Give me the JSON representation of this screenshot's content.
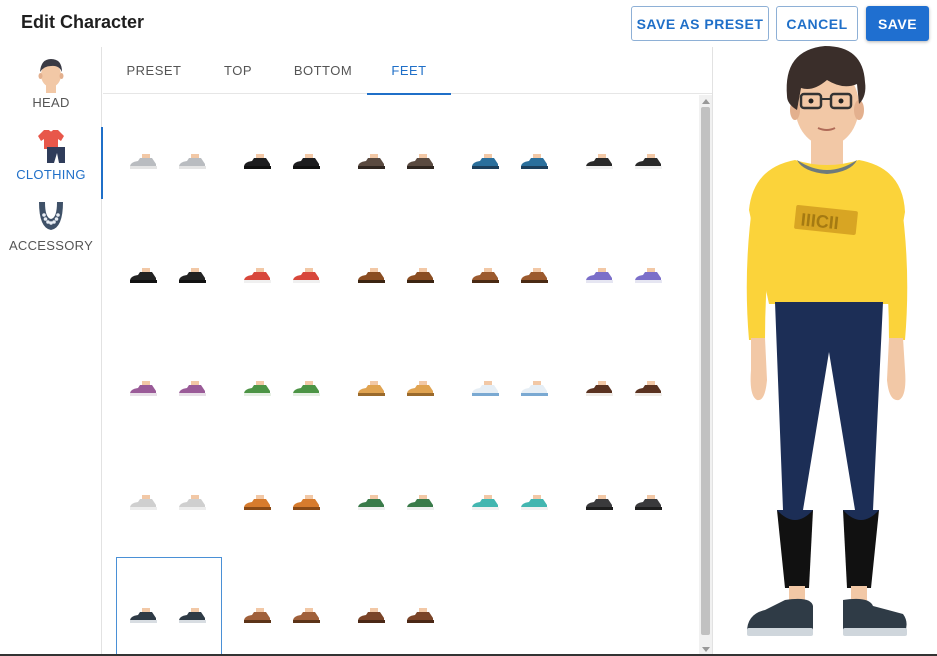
{
  "header": {
    "title": "Edit Character",
    "save_as_preset": "SAVE AS PRESET",
    "cancel": "CANCEL",
    "save": "SAVE"
  },
  "categories": [
    {
      "label": "HEAD",
      "icon": "head-icon",
      "active": false
    },
    {
      "label": "CLOTHING",
      "icon": "clothing-icon",
      "active": true
    },
    {
      "label": "ACCESSORY",
      "icon": "necklace-icon",
      "active": false
    }
  ],
  "tabs": [
    {
      "label": "PRESET",
      "active": false
    },
    {
      "label": "TOP",
      "active": false
    },
    {
      "label": "BOTTOM",
      "active": false
    },
    {
      "label": "FEET",
      "active": true
    }
  ],
  "shoes": [
    {
      "name": "grey-sneaker",
      "color": "#b9bcc0",
      "sole": "#e4e4e4"
    },
    {
      "name": "black-dress-shoe",
      "color": "#1d1d1f",
      "sole": "#111111"
    },
    {
      "name": "dark-brown-shoe",
      "color": "#5a4a40",
      "sole": "#2f2620"
    },
    {
      "name": "blue-shoe",
      "color": "#2a6f9c",
      "sole": "#1c3f5c"
    },
    {
      "name": "black-white-sandal",
      "color": "#2a2a2a",
      "sole": "#f2f2f2"
    },
    {
      "name": "black-flat",
      "color": "#232323",
      "sole": "#111111"
    },
    {
      "name": "red-white-sneaker",
      "color": "#d8473b",
      "sole": "#f0f0f0"
    },
    {
      "name": "brown-loafer",
      "color": "#8a4d22",
      "sole": "#3b2412"
    },
    {
      "name": "tan-loafer",
      "color": "#9c5a2e",
      "sole": "#4a2a14"
    },
    {
      "name": "purple-sneaker",
      "color": "#7b6fc9",
      "sole": "#e6e6f2"
    },
    {
      "name": "mauve-sneaker",
      "color": "#9a5b98",
      "sole": "#e8e0e8"
    },
    {
      "name": "green-sneaker",
      "color": "#4c9445",
      "sole": "#e6efe4"
    },
    {
      "name": "tan-boot",
      "color": "#e0a351",
      "sole": "#9a6a2c"
    },
    {
      "name": "white-blue-sneaker",
      "color": "#e6eef5",
      "sole": "#7aa9d2"
    },
    {
      "name": "brown-boot",
      "color": "#5a3220",
      "sole": "#f0ece8"
    },
    {
      "name": "light-grey-sneaker",
      "color": "#cfcfcf",
      "sole": "#ededed"
    },
    {
      "name": "orange-sandal",
      "color": "#d77b2d",
      "sole": "#8a4a16"
    },
    {
      "name": "green-stripe-sneaker",
      "color": "#3a7b4a",
      "sole": "#f0f0f0"
    },
    {
      "name": "teal-sneaker",
      "color": "#43b6b0",
      "sole": "#f2f2f2"
    },
    {
      "name": "charcoal-shoe",
      "color": "#3a3a3c",
      "sole": "#1d1d1d"
    },
    {
      "name": "navy-sneaker",
      "color": "#2f3b46",
      "sole": "#d8dde2"
    },
    {
      "name": "brown-sandal",
      "color": "#a0603a",
      "sole": "#5c3418"
    },
    {
      "name": "brown-clog",
      "color": "#7a4428",
      "sole": "#4a2816"
    }
  ],
  "selected_shoe": 20,
  "colors": {
    "accent": "#1f6fc8",
    "skin": "#f2c8a6",
    "hair": "#3a2e2a",
    "sweater": "#fbd33a",
    "pants": "#1c2e56",
    "boots": "#111111"
  }
}
